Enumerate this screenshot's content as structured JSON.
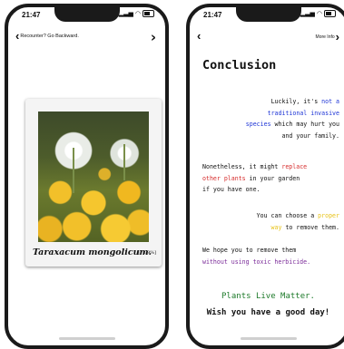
{
  "status_bar": {
    "time": "21:47"
  },
  "left_screen": {
    "back_label": "Recounter? Go Backward.",
    "plant_name": "Taraxacum mongolicum.",
    "confidence": "[78.9%]"
  },
  "right_screen": {
    "more_label": "More Info",
    "title": "Conclusion",
    "p1": {
      "a": "Luckily, it's ",
      "b": "not a",
      "c": "traditional invasive",
      "d": "species",
      "e": " which may hurt you",
      "f": "and your family."
    },
    "p2": {
      "a": "Nonetheless, it might ",
      "b": "replace",
      "c": "other plants",
      "d": " in your garden",
      "e": "if you have one."
    },
    "p3": {
      "a": "You can choose a ",
      "b": "proper",
      "c": "way",
      "d": " to remove them."
    },
    "p4": {
      "a": "We hope you to remove them",
      "b": "without using toxic herbicide."
    },
    "closing_1": "Plants Live Matter.",
    "closing_2": "Wish you have a good day!"
  },
  "colors": {
    "blue": "#1e35d6",
    "red": "#d62b2b",
    "yellow": "#e8c31a",
    "purple": "#7a2a98",
    "green": "#1d7a2a"
  }
}
